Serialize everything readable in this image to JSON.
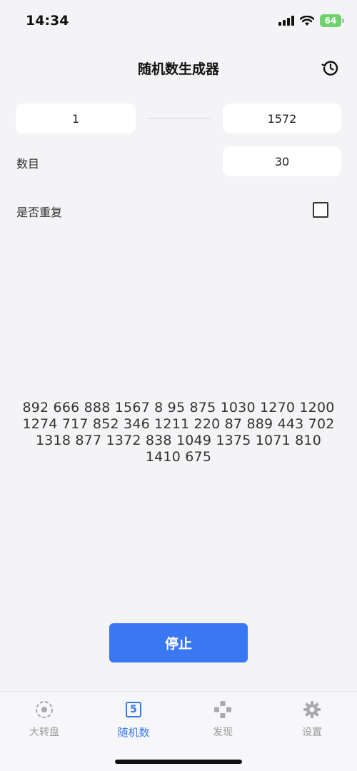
{
  "status_bar": {
    "time": "14:34",
    "battery": "64"
  },
  "header": {
    "title": "随机数生成器",
    "history_icon": "history-icon"
  },
  "range": {
    "min": "1",
    "max": "1572"
  },
  "count": {
    "label": "数目",
    "value": "30"
  },
  "repeat": {
    "label": "是否重复",
    "checked": false
  },
  "results": {
    "text": "892 666 888 1567 8 95 875 1030 1270 1200 1274 717 852 346 1211 220 87 889 443 702 1318 877 1372 838 1049 1375 1071 810 1410 675"
  },
  "stop_button": {
    "label": "停止"
  },
  "tabs": [
    {
      "label": "大转盘",
      "icon": "wheel-icon",
      "active": false
    },
    {
      "label": "随机数",
      "icon": "number-five-icon",
      "icon_text": "5",
      "active": true
    },
    {
      "label": "发现",
      "icon": "gamepad-icon",
      "active": false
    },
    {
      "label": "设置",
      "icon": "gear-icon",
      "active": false
    }
  ],
  "colors": {
    "accent": "#3a78f2",
    "background": "#f4f4f6",
    "inactive_tab": "#999999"
  }
}
